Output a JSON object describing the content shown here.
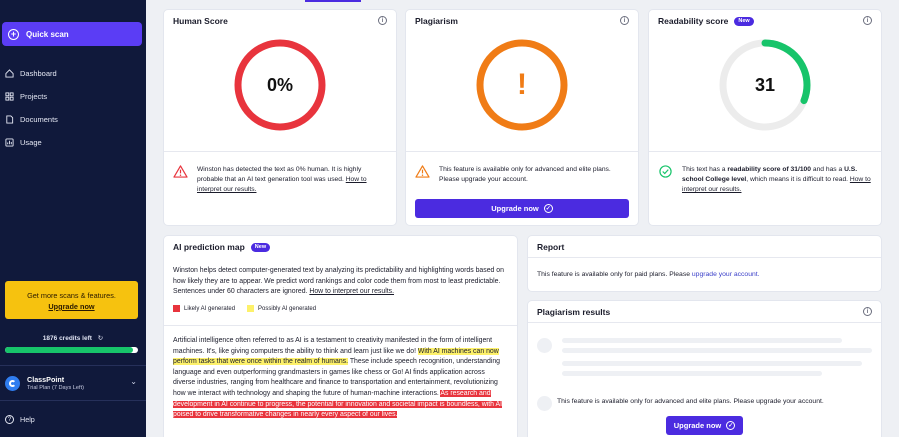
{
  "sidebar": {
    "quick_scan": "Quick scan",
    "items": [
      {
        "label": "Dashboard",
        "icon": "dashboard-icon"
      },
      {
        "label": "Projects",
        "icon": "projects-icon"
      },
      {
        "label": "Documents",
        "icon": "documents-icon"
      },
      {
        "label": "Usage",
        "icon": "usage-icon"
      }
    ],
    "promo": {
      "text": "Get more scans & features.",
      "link": "Upgrade now"
    },
    "credits": "1876 credits left",
    "credits_fraction": 0.96,
    "account": {
      "name": "ClassPoint",
      "plan": "Trial Plan (7 Days Left)"
    },
    "help": "Help"
  },
  "human_score": {
    "title": "Human Score",
    "value": "0%",
    "message": "Winston has detected the text as 0% human. It is highly probable that an AI text generation tool was used.",
    "link": "How to interpret our results."
  },
  "plagiarism": {
    "title": "Plagiarism",
    "symbol": "!",
    "message": "This feature is available only for advanced and elite plans. Please upgrade your account.",
    "button": "Upgrade now"
  },
  "readability": {
    "title": "Readability score",
    "badge": "New",
    "value": "31",
    "score_fraction": 0.31,
    "msg_1": "This text has a ",
    "msg_bold_1": "readability score of 31/100",
    "msg_2": " and has a ",
    "msg_bold_2": "U.S. school College level",
    "msg_3": ", which means it is difficult to read. ",
    "link": "How to interpret our results."
  },
  "ai_map": {
    "title": "AI prediction map",
    "badge": "New",
    "intro": "Winston helps detect computer-generated text by analyzing its predictability and highlighting words based on how likely they are to appear. We predict word rankings and color code them from most to least predictable. Sentences under 60 characters are ignored. ",
    "intro_link": "How to interpret our results.",
    "legend_likely": "Likely AI generated",
    "legend_possibly": "Possibly AI generated",
    "seg1": "Artificial intelligence often referred to as AI is a testament to creativity manifested in the form of intelligent machines. It's, like giving computers the ability to think and learn just like we do! ",
    "seg2": "With AI machines can now perform tasks that were once within the realm of humans.",
    "seg3": " These include speech recognition, understanding language and even outperforming grandmasters in games like chess or Go! AI finds application across diverse industries, ranging from healthcare and finance to transportation and entertainment, revolutionizing how we interact with technology and shaping the future of human-machine interactions. ",
    "seg4": "As research and development in AI continue to progress, the potential for innovation and societal impact is boundless, with AI poised to drive transformative changes in nearly every aspect of our lives."
  },
  "report": {
    "title": "Report",
    "text": "This feature is available only for paid plans. Please ",
    "link": "upgrade your account."
  },
  "plag_results": {
    "title": "Plagiarism results",
    "text": "This feature is available only for advanced and elite plans. Please upgrade your account.",
    "button": "Upgrade now"
  },
  "colors": {
    "accent": "#4b2be0",
    "quick_scan": "#5b3df5",
    "red": "#e8343d",
    "orange": "#f07c16",
    "green": "#17c46a",
    "sidebar": "#10193b",
    "promo": "#f6c20f"
  }
}
